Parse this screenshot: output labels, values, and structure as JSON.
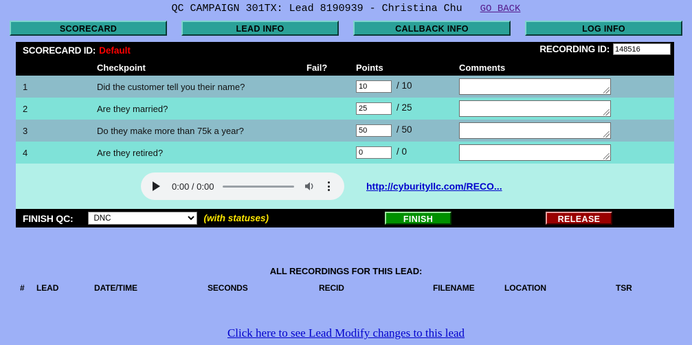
{
  "header": {
    "title": "QC CAMPAIGN 301TX: Lead 8190939 - Christina Chu",
    "go_back": "GO BACK"
  },
  "tabs": [
    {
      "label": "SCORECARD",
      "name": "tab-scorecard"
    },
    {
      "label": "LEAD INFO",
      "name": "tab-lead-info"
    },
    {
      "label": "CALLBACK INFO",
      "name": "tab-callback-info"
    },
    {
      "label": "LOG INFO",
      "name": "tab-log-info"
    }
  ],
  "scorecard": {
    "id_label": "SCORECARD ID:",
    "id_value": "Default",
    "recording_id_label": "RECORDING ID:",
    "recording_id_value": "148516",
    "columns": {
      "num": "",
      "checkpoint": "Checkpoint",
      "fail": "Fail?",
      "points": "Points",
      "comments": "Comments"
    },
    "rows": [
      {
        "num": "1",
        "checkpoint": "Did the customer tell you their name?",
        "fail": "",
        "points": "10",
        "max": "/ 10",
        "comment": ""
      },
      {
        "num": "2",
        "checkpoint": "Are they married?",
        "fail": "",
        "points": "25",
        "max": "/ 25",
        "comment": ""
      },
      {
        "num": "3",
        "checkpoint": "Do they make more than 75k a year?",
        "fail": "",
        "points": "50",
        "max": "/ 50",
        "comment": ""
      },
      {
        "num": "4",
        "checkpoint": "Are they retired?",
        "fail": "",
        "points": "0",
        "max": "/ 0",
        "comment": ""
      }
    ]
  },
  "player": {
    "time": "0:00 / 0:00",
    "play_icon": "play-icon",
    "volume_icon": "volume-icon",
    "menu_icon": "more-vertical-icon",
    "recording_link": "http://cyburityllc.com/RECO..."
  },
  "finish": {
    "label": "FINISH QC:",
    "status_value": "DNC",
    "status_options": [
      "DNC"
    ],
    "with_statuses": "(with statuses)",
    "finish_button": "FINISH",
    "release_button": "RELEASE"
  },
  "recordings": {
    "title": "ALL RECORDINGS FOR THIS LEAD:",
    "columns": [
      "#",
      "LEAD",
      "DATE/TIME",
      "SECONDS",
      "RECID",
      "FILENAME",
      "LOCATION",
      "TSR"
    ],
    "rows": []
  },
  "footer": {
    "lead_modify_link": "Click here to see Lead Modify changes to this lead"
  },
  "colors": {
    "page_bg": "#9db0f7",
    "tab_bg": "#2ba198",
    "row_odd": "#8cbcc9",
    "row_even": "#7fe2d8",
    "player_row": "#b2f0e8",
    "finish_green": "#009000",
    "release_red": "#990000",
    "accent_red": "#ff0000",
    "accent_yellow": "#ffe600"
  }
}
